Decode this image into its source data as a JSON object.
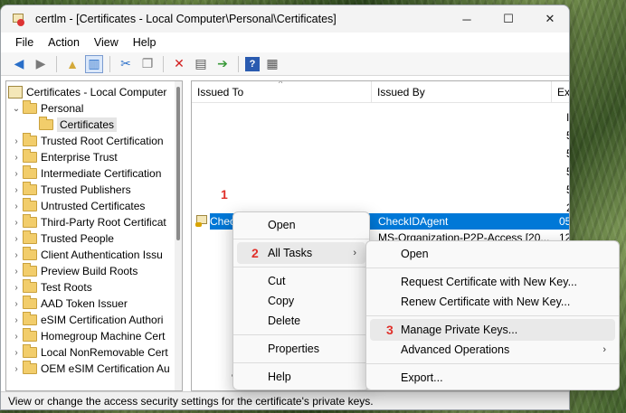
{
  "window": {
    "title": "certlm - [Certificates - Local Computer\\Personal\\Certificates]",
    "minimize": "─",
    "maximize": "☐",
    "close": "✕"
  },
  "menubar": [
    "File",
    "Action",
    "View",
    "Help"
  ],
  "toolbar": [
    "back-icon",
    "forward-icon",
    "up-folder-icon",
    "show-hide-tree-icon",
    "cut-icon",
    "copy-icon",
    "delete-icon",
    "properties-icon",
    "export-icon",
    "help-icon",
    "view-icon"
  ],
  "tree": [
    {
      "label": "Certificates - Local Computer",
      "chev": "",
      "indent": 0
    },
    {
      "label": "Personal",
      "chev": "⌄",
      "indent": 1
    },
    {
      "label": "Certificates",
      "chev": "",
      "indent": 2,
      "selected": true
    },
    {
      "label": "Trusted Root Certification",
      "chev": "›",
      "indent": 1
    },
    {
      "label": "Enterprise Trust",
      "chev": "›",
      "indent": 1
    },
    {
      "label": "Intermediate Certification",
      "chev": "›",
      "indent": 1
    },
    {
      "label": "Trusted Publishers",
      "chev": "›",
      "indent": 1
    },
    {
      "label": "Untrusted Certificates",
      "chev": "›",
      "indent": 1
    },
    {
      "label": "Third-Party Root Certificat",
      "chev": "›",
      "indent": 1
    },
    {
      "label": "Trusted People",
      "chev": "›",
      "indent": 1
    },
    {
      "label": "Client Authentication Issu",
      "chev": "›",
      "indent": 1
    },
    {
      "label": "Preview Build Roots",
      "chev": "›",
      "indent": 1
    },
    {
      "label": "Test Roots",
      "chev": "›",
      "indent": 1
    },
    {
      "label": "AAD Token Issuer",
      "chev": "›",
      "indent": 1
    },
    {
      "label": "eSIM Certification Authori",
      "chev": "›",
      "indent": 1
    },
    {
      "label": "Homegroup Machine Cert",
      "chev": "›",
      "indent": 1
    },
    {
      "label": "Local NonRemovable Cert",
      "chev": "›",
      "indent": 1
    },
    {
      "label": "OEM eSIM Certification Au",
      "chev": "›",
      "indent": 1
    }
  ],
  "list": {
    "columns": [
      "Issued To",
      "Issued By",
      "Ex"
    ],
    "exp_fragments": [
      "I",
      "5",
      "5",
      "5",
      "5",
      "2"
    ],
    "rows": [
      {
        "issued_to": "CheckIDAgent",
        "issued_by": "CheckIDAgent",
        "exp": "05"
      },
      {
        "issued_to": "",
        "issued_by": "MS-Organization-P2P-Access [20...",
        "exp": "12"
      }
    ]
  },
  "context_menu": {
    "items": [
      "Open",
      "All Tasks",
      "Cut",
      "Copy",
      "Delete",
      "Properties",
      "Help"
    ]
  },
  "submenu": {
    "items": [
      "Open",
      "Request Certificate with New Key...",
      "Renew Certificate with New Key...",
      "Manage Private Keys...",
      "Advanced Operations",
      "Export..."
    ]
  },
  "steps": [
    "1",
    "2",
    "3"
  ],
  "status": "View or change the access security settings for the certificate's private keys."
}
